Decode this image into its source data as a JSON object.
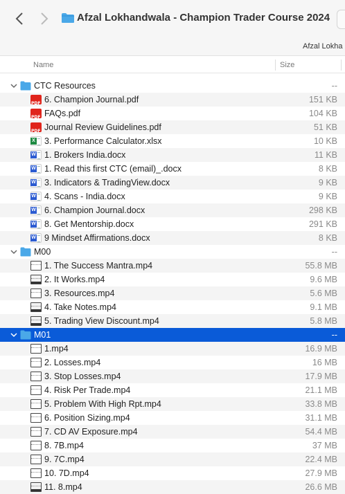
{
  "window": {
    "title": "Afzal Lokhandwala - Champion Trader Course 2024",
    "path_label": "Afzal Lokha"
  },
  "columns": {
    "name": "Name",
    "size": "Size"
  },
  "rows": [
    {
      "kind": "folder",
      "level": 0,
      "expanded": true,
      "name": "CTC Resources",
      "size": "--"
    },
    {
      "kind": "pdf",
      "level": 1,
      "name": "6. Champion Journal.pdf",
      "size": "151 KB"
    },
    {
      "kind": "pdf",
      "level": 1,
      "name": "FAQs.pdf",
      "size": "104 KB"
    },
    {
      "kind": "pdf",
      "level": 1,
      "name": "Journal Review Guidelines.pdf",
      "size": "51 KB"
    },
    {
      "kind": "xlsx",
      "level": 1,
      "name": "3. Performance Calculator.xlsx",
      "size": "10 KB"
    },
    {
      "kind": "docx",
      "level": 1,
      "name": "1. Brokers India.docx",
      "size": "11 KB"
    },
    {
      "kind": "docx",
      "level": 1,
      "name": "1. Read this first CTC (email)_.docx",
      "size": "8 KB"
    },
    {
      "kind": "docx",
      "level": 1,
      "name": "3. Indicators & TradingView.docx",
      "size": "9 KB"
    },
    {
      "kind": "docx",
      "level": 1,
      "name": "4. Scans - India.docx",
      "size": "9 KB"
    },
    {
      "kind": "docx",
      "level": 1,
      "name": "6. Champion Journal.docx",
      "size": "298 KB"
    },
    {
      "kind": "docx",
      "level": 1,
      "name": "8. Get Mentorship.docx",
      "size": "291 KB"
    },
    {
      "kind": "docx",
      "level": 1,
      "name": "9 Mindset Affirmations.docx",
      "size": "8 KB"
    },
    {
      "kind": "folder",
      "level": 0,
      "expanded": true,
      "name": "M00",
      "size": "--"
    },
    {
      "kind": "mp4",
      "level": 1,
      "name": "1. The Success Mantra.mp4",
      "size": "55.8 MB"
    },
    {
      "kind": "mp4dark",
      "level": 1,
      "name": "2. It Works.mp4",
      "size": "9.6 MB"
    },
    {
      "kind": "mp4",
      "level": 1,
      "name": "3. Resources.mp4",
      "size": "5.6 MB"
    },
    {
      "kind": "mp4dark",
      "level": 1,
      "name": "4. Take Notes.mp4",
      "size": "9.1 MB"
    },
    {
      "kind": "mp4dark",
      "level": 1,
      "name": "5. Trading View Discount.mp4",
      "size": "5.8 MB"
    },
    {
      "kind": "folder",
      "level": 0,
      "expanded": true,
      "selected": true,
      "name": "M01",
      "size": "--"
    },
    {
      "kind": "mp4",
      "level": 1,
      "name": "1.mp4",
      "size": "16.9 MB"
    },
    {
      "kind": "mp4",
      "level": 1,
      "name": "2. Losses.mp4",
      "size": "16 MB"
    },
    {
      "kind": "mp4",
      "level": 1,
      "name": "3. Stop Losses.mp4",
      "size": "17.9 MB"
    },
    {
      "kind": "mp4",
      "level": 1,
      "name": "4. Risk Per Trade.mp4",
      "size": "21.1 MB"
    },
    {
      "kind": "mp4",
      "level": 1,
      "name": "5. Problem With High Rpt.mp4",
      "size": "33.8 MB"
    },
    {
      "kind": "mp4",
      "level": 1,
      "name": "6. Position Sizing.mp4",
      "size": "31.1 MB"
    },
    {
      "kind": "mp4",
      "level": 1,
      "name": "7. CD AV Exposure.mp4",
      "size": "54.4 MB"
    },
    {
      "kind": "mp4",
      "level": 1,
      "name": "8. 7B.mp4",
      "size": "37 MB"
    },
    {
      "kind": "mp4",
      "level": 1,
      "name": "9. 7C.mp4",
      "size": "22.4 MB"
    },
    {
      "kind": "mp4",
      "level": 1,
      "name": "10. 7D.mp4",
      "size": "27.9 MB"
    },
    {
      "kind": "mp4dark",
      "level": 1,
      "name": "11. 8.mp4",
      "size": "26.6 MB"
    }
  ],
  "colors": {
    "folder": "#4aa8e8",
    "selection": "#0a5bd8",
    "pdf": "#e0241b",
    "excel": "#1e8a43",
    "word": "#2b5bd1"
  }
}
